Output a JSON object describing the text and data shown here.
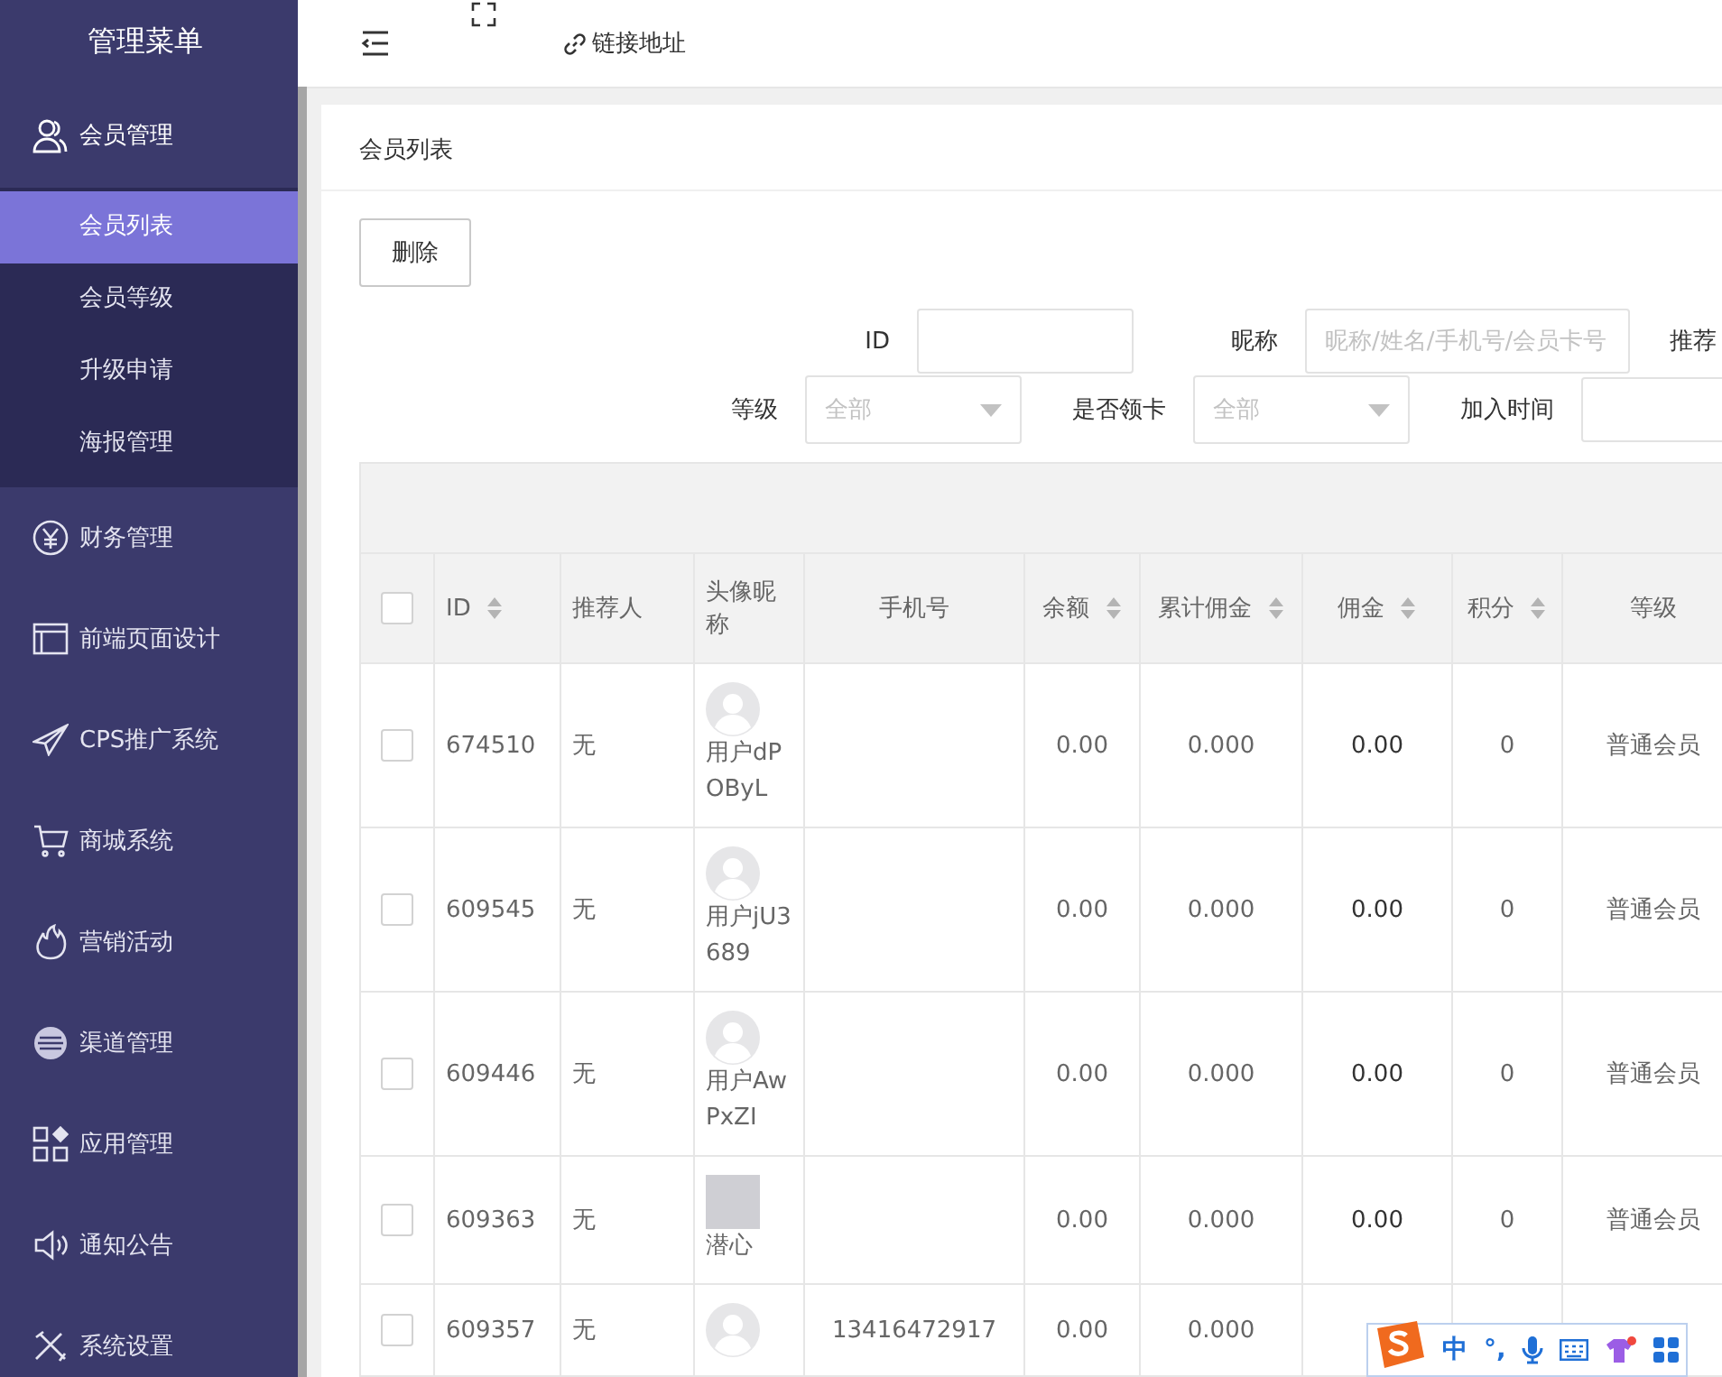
{
  "sidebar": {
    "title": "管理菜单",
    "items": [
      {
        "label": "会员管理",
        "kind": "user",
        "expanded": true,
        "children": [
          {
            "label": "会员列表",
            "selected": true
          },
          {
            "label": "会员等级",
            "selected": false
          },
          {
            "label": "升级申请",
            "selected": false
          },
          {
            "label": "海报管理",
            "selected": false
          }
        ]
      },
      {
        "label": "财务管理",
        "kind": "yen",
        "expanded": false
      },
      {
        "label": "前端页面设计",
        "kind": "window",
        "expanded": false
      },
      {
        "label": "CPS推广系统",
        "kind": "plane",
        "expanded": false
      },
      {
        "label": "商城系统",
        "kind": "cart",
        "expanded": false
      },
      {
        "label": "营销活动",
        "kind": "fire",
        "expanded": false
      },
      {
        "label": "渠道管理",
        "kind": "disc",
        "expanded": false
      },
      {
        "label": "应用管理",
        "kind": "apps",
        "expanded": false
      },
      {
        "label": "通知公告",
        "kind": "speaker",
        "expanded": false
      },
      {
        "label": "系统设置",
        "kind": "tools",
        "expanded": false
      }
    ]
  },
  "header": {
    "link": "链接地址"
  },
  "card": {
    "title": "会员列表",
    "delete_button": "删除",
    "filters": [
      [
        {
          "label": "ID",
          "kind": "input"
        },
        {
          "label": "昵称",
          "kind": "input",
          "placeholder": "昵称/姓名/手机号/会员卡号"
        },
        {
          "label": "推荐",
          "kind": "none"
        }
      ],
      [
        {
          "label": "等级",
          "kind": "select",
          "value": "全部"
        },
        {
          "label": "是否领卡",
          "kind": "select",
          "value": "全部"
        },
        {
          "label": "加入时间",
          "kind": "input"
        }
      ]
    ],
    "table": {
      "select_all_checked": false,
      "columns": [
        {
          "label": "ID",
          "sortable": true
        },
        {
          "label": "推荐人",
          "sortable": false
        },
        {
          "label": "头像昵称",
          "sortable": false
        },
        {
          "label": "手机号",
          "sortable": false
        },
        {
          "label": "余额",
          "sortable": true
        },
        {
          "label": "累计佣金",
          "sortable": true
        },
        {
          "label": "佣金",
          "sortable": true
        },
        {
          "label": "积分",
          "sortable": true
        },
        {
          "label": "等级",
          "sortable": false
        }
      ],
      "rows": [
        {
          "checked": false,
          "id": "674510",
          "referrer": "无",
          "kind": "default",
          "nickname": "用户dPOByL",
          "balance": "0.00",
          "total_commission": "0.000",
          "commission": "0.00",
          "points": "0",
          "level": "普通会员"
        },
        {
          "checked": false,
          "id": "609545",
          "referrer": "无",
          "kind": "default",
          "nickname": "用户jU3689",
          "balance": "0.00",
          "total_commission": "0.000",
          "commission": "0.00",
          "points": "0",
          "level": "普通会员"
        },
        {
          "checked": false,
          "id": "609446",
          "referrer": "无",
          "kind": "default",
          "nickname": "用户AwPxZI",
          "balance": "0.00",
          "total_commission": "0.000",
          "commission": "0.00",
          "points": "0",
          "level": "普通会员"
        },
        {
          "checked": false,
          "id": "609363",
          "referrer": "无",
          "kind": "photo",
          "nickname": "潜心",
          "balance": "0.00",
          "total_commission": "0.000",
          "commission": "0.00",
          "points": "0",
          "level": "普通会员"
        },
        {
          "checked": false,
          "id": "609357",
          "referrer": "无",
          "kind": "default",
          "phone": "13416472917",
          "balance": "0.00",
          "total_commission": "0.000"
        }
      ]
    }
  },
  "ime_toolbar": {
    "mode": "中",
    "punctuation": "°,"
  }
}
